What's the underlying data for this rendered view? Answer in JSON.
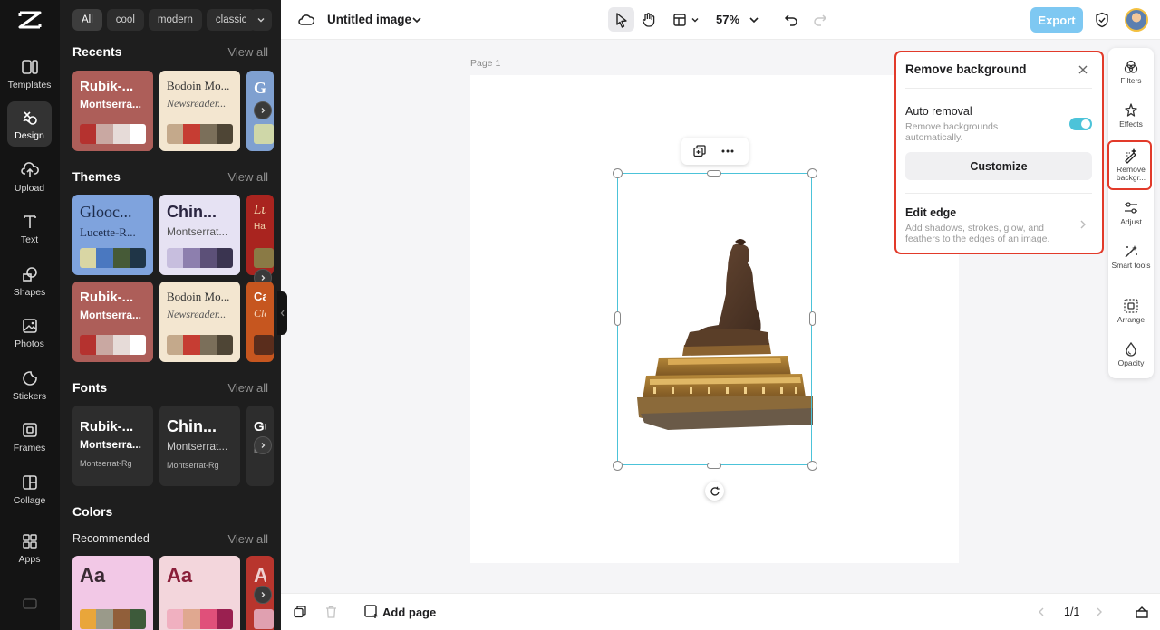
{
  "rail": {
    "items": [
      {
        "label": "Templates",
        "icon": "templates-icon"
      },
      {
        "label": "Design",
        "icon": "design-icon",
        "active": true
      },
      {
        "label": "Upload",
        "icon": "upload-icon"
      },
      {
        "label": "Text",
        "icon": "text-icon"
      },
      {
        "label": "Shapes",
        "icon": "shapes-icon"
      },
      {
        "label": "Photos",
        "icon": "photos-icon"
      },
      {
        "label": "Stickers",
        "icon": "stickers-icon"
      },
      {
        "label": "Frames",
        "icon": "frames-icon"
      },
      {
        "label": "Collage",
        "icon": "collage-icon"
      },
      {
        "label": "Apps",
        "icon": "apps-icon"
      }
    ]
  },
  "panel": {
    "chips": [
      "All",
      "cool",
      "modern",
      "classic"
    ],
    "recents": {
      "title": "Recents",
      "view_all": "View all",
      "cards": [
        {
          "t1": "Rubik-...",
          "t2": "Montserra...",
          "colors": [
            "#b5322f",
            "#c9a8a2",
            "#e6dbd8",
            "#ffffff"
          ],
          "bg": "#ad5e59"
        },
        {
          "t1": "Bodoin Mo...",
          "t2": "Newsreader...",
          "colors": [
            "#c4a98b",
            "#c63d33",
            "#7b6f5a",
            "#4e4535"
          ],
          "bg": "#f3e6d0"
        },
        {
          "t1": "G",
          "t2": "",
          "colors": [
            "#cfd7a8"
          ],
          "bg": "#7fa0d0"
        }
      ]
    },
    "themes": {
      "title": "Themes",
      "view_all": "View all",
      "cards": [
        {
          "t1": "Glooc...",
          "t2": "Lucette-R...",
          "colors": [
            "#d9d6a4",
            "#4a78c0",
            "#465a37",
            "#1f3547"
          ],
          "bg": "#7fa3dd"
        },
        {
          "t1": "Chin...",
          "t2": "Montserrat...",
          "colors": [
            "#c7bede",
            "#8d7fae",
            "#5c5078",
            "#3a3450"
          ],
          "bg": "#e6e2f3"
        },
        {
          "t1": "Lu",
          "t2": "Has",
          "colors": [
            "#8a7a45"
          ],
          "bg": "#a9241f"
        },
        {
          "t1": "Rubik-...",
          "t2": "Montserra...",
          "colors": [
            "#b5322f",
            "#c9a8a2",
            "#e6dbd8",
            "#ffffff"
          ],
          "bg": "#ad5e59"
        },
        {
          "t1": "Bodoin Mo...",
          "t2": "Newsreader...",
          "colors": [
            "#c4a98b",
            "#c63d33",
            "#7b6f5a",
            "#4e4535"
          ],
          "bg": "#f3e6d0"
        },
        {
          "t1": "Ca",
          "t2": "Cle",
          "colors": [
            "#5a2d1c"
          ],
          "bg": "#c6561f"
        }
      ]
    },
    "fonts": {
      "title": "Fonts",
      "view_all": "View all",
      "cards": [
        {
          "t1": "Rubik-...",
          "t2": "Montserra...",
          "t3": "Montserrat-Rg"
        },
        {
          "t1": "Chin...",
          "t2": "Montserrat...",
          "t3": "Montserrat-Rg"
        },
        {
          "t1": "Gu",
          "t2": "",
          "t3": "Mor"
        }
      ]
    },
    "colors": {
      "title": "Colors",
      "subtitle": "Recommended",
      "view_all": "View all",
      "cards": [
        {
          "t1": "Aa",
          "bg": "#f2c8e6",
          "fg": "#3a2a33",
          "colors": [
            "#e9a63a",
            "#9a9a8a",
            "#915f3a",
            "#3d5a3a"
          ]
        },
        {
          "t1": "Aa",
          "bg": "#f3d6dc",
          "fg": "#8a1f3a",
          "colors": [
            "#f0b0c0",
            "#e0a890",
            "#e0507a",
            "#9a2050"
          ]
        },
        {
          "t1": "A",
          "bg": "#b8352d",
          "fg": "#f0d0d0",
          "colors": [
            "#e0a0b0"
          ]
        }
      ]
    }
  },
  "topbar": {
    "title": "Untitled image",
    "zoom": "57%",
    "export_label": "Export",
    "accent": "#7ec8f2"
  },
  "canvas": {
    "page_label": "Page 1"
  },
  "right_tools": [
    {
      "label": "Filters",
      "icon": "filters-icon"
    },
    {
      "label": "Effects",
      "icon": "effects-icon"
    },
    {
      "label": "Remove backgr...",
      "icon": "remove-background-icon",
      "active": true
    },
    {
      "label": "Adjust",
      "icon": "adjust-icon"
    },
    {
      "label": "Smart tools",
      "icon": "smart-tools-icon"
    },
    {
      "label": "Arrange",
      "icon": "arrange-icon"
    },
    {
      "label": "Opacity",
      "icon": "opacity-icon"
    }
  ],
  "popup": {
    "title": "Remove background",
    "auto_title": "Auto removal",
    "auto_desc": "Remove backgrounds automatically.",
    "auto_enabled": true,
    "customize_label": "Customize",
    "edge_title": "Edit edge",
    "edge_desc": "Add shadows, strokes, glow, and feathers to the edges of an image.",
    "highlight_color": "#e23a2a"
  },
  "bottombar": {
    "add_page_label": "Add page",
    "page_indicator": "1/1"
  }
}
